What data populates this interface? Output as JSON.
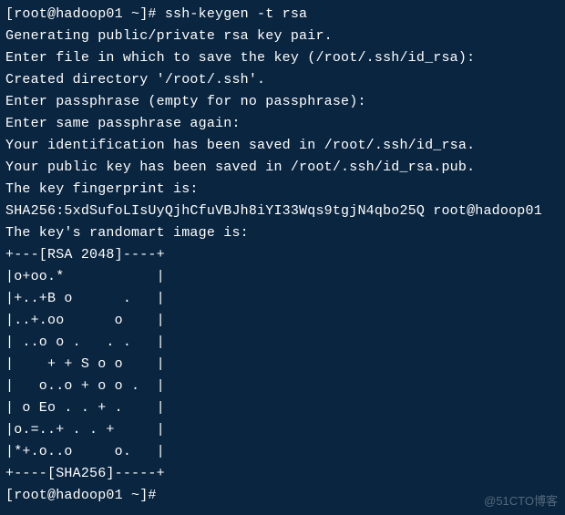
{
  "terminal": {
    "lines": [
      "[root@hadoop01 ~]# ssh-keygen -t rsa",
      "Generating public/private rsa key pair.",
      "Enter file in which to save the key (/root/.ssh/id_rsa):",
      "Created directory '/root/.ssh'.",
      "Enter passphrase (empty for no passphrase):",
      "Enter same passphrase again:",
      "Your identification has been saved in /root/.ssh/id_rsa.",
      "Your public key has been saved in /root/.ssh/id_rsa.pub.",
      "The key fingerprint is:",
      "SHA256:5xdSufoLIsUyQjhCfuVBJh8iYI33Wqs9tgjN4qbo25Q root@hadoop01",
      "The key's randomart image is:",
      "+---[RSA 2048]----+",
      "|o+oo.*           |",
      "|+..+B o      .   |",
      "|..+.oo      o    |",
      "| ..o o .   . .   |",
      "|    + + S o o    |",
      "|   o..o + o o .  |",
      "| o Eo . . + .    |",
      "|o.=..+ . . +     |",
      "|*+.o..o     o.   |",
      "+----[SHA256]-----+",
      "[root@hadoop01 ~]# "
    ]
  },
  "watermark": "@51CTO博客"
}
